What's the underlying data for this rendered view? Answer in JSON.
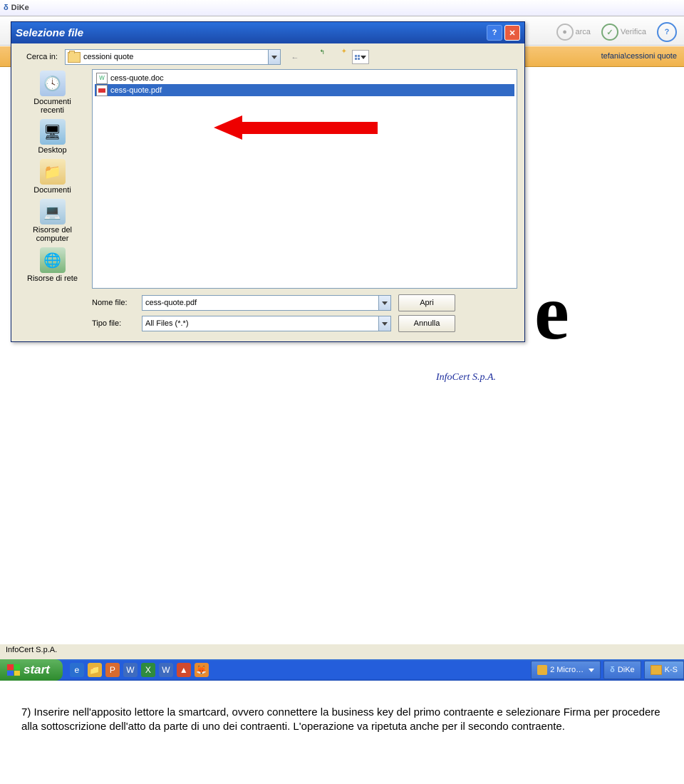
{
  "app": {
    "title": "DiKe",
    "icon_letter": "δ"
  },
  "toolbar": {
    "btn_arca": "arca",
    "btn_verifica": "Verifica",
    "help": "?"
  },
  "path_bar": {
    "right_text": "tefania\\cessioni quote"
  },
  "dialog": {
    "title": "Selezione file",
    "look_in_label": "Cerca in:",
    "look_in_value": "cessioni quote",
    "places": {
      "recent": "Documenti\nrecenti",
      "desktop": "Desktop",
      "documents": "Documenti",
      "computer": "Risorse del\ncomputer",
      "network": "Risorse di rete"
    },
    "files": {
      "doc": "cess-quote.doc",
      "pdf": "cess-quote.pdf"
    },
    "filename_label": "Nome file:",
    "filename_value": "cess-quote.pdf",
    "filetype_label": "Tipo file:",
    "filetype_value": "All Files (*.*)",
    "open_btn": "Apri",
    "cancel_btn": "Annulla"
  },
  "brand_overlay": "InfoCert S.p.A.",
  "big_e": "e",
  "status_bar": {
    "text": "InfoCert S.p.A."
  },
  "taskbar": {
    "start": "start",
    "items": {
      "micro": "2 Micro…",
      "dike": "DiKe",
      "ks": "K-S"
    }
  },
  "instruction": "7) Inserire nell'apposito lettore la smartcard, ovvero connettere la business key del primo contraente e selezionare Firma per procedere alla sottoscrizione dell'atto da parte di uno dei contraenti. L'operazione va ripetuta anche per il secondo contraente."
}
